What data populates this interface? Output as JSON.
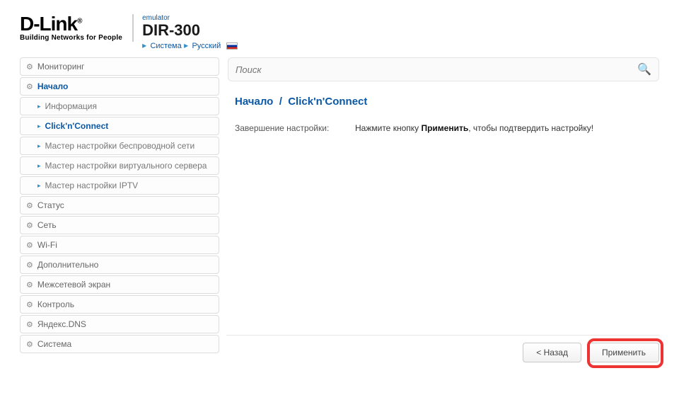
{
  "header": {
    "logo_main": "D-Link",
    "logo_tag": "Building Networks for People",
    "emulator": "emulator",
    "model": "DIR-300",
    "crumb_system": "Система",
    "crumb_lang": "Русский"
  },
  "sidebar": {
    "items": [
      {
        "label": "Мониторинг"
      },
      {
        "label": "Начало",
        "active": true
      },
      {
        "label": "Статус"
      },
      {
        "label": "Сеть"
      },
      {
        "label": "Wi-Fi"
      },
      {
        "label": "Дополнительно"
      },
      {
        "label": "Межсетевой экран"
      },
      {
        "label": "Контроль"
      },
      {
        "label": "Яндекс.DNS"
      },
      {
        "label": "Система"
      }
    ],
    "sub": [
      {
        "label": "Информация"
      },
      {
        "label": "Click'n'Connect",
        "active": true
      },
      {
        "label": "Мастер настройки беспроводной сети"
      },
      {
        "label": "Мастер настройки виртуального сервера"
      },
      {
        "label": "Мастер настройки IPTV"
      }
    ]
  },
  "search": {
    "placeholder": "Поиск"
  },
  "content": {
    "breadcrumb_root": "Начало",
    "breadcrumb_sep": "/",
    "breadcrumb_page": "Click'n'Connect",
    "row_label": "Завершение настройки:",
    "row_value_pre": "Нажмите кнопку ",
    "row_value_bold": "Применить",
    "row_value_post": ", чтобы подтвердить настройку!"
  },
  "footer": {
    "back": "< Назад",
    "apply": "Применить"
  }
}
